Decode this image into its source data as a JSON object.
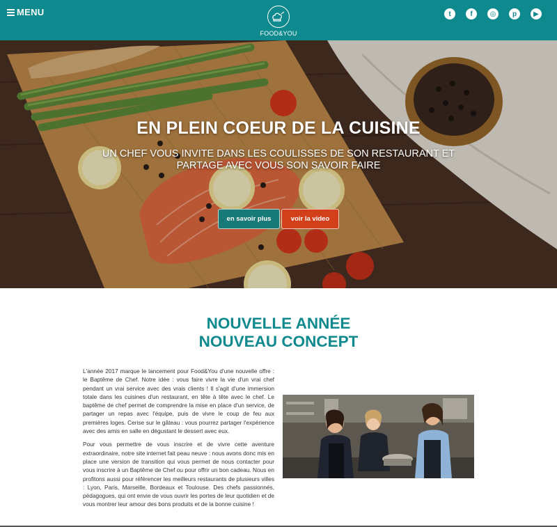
{
  "header": {
    "menu_label": "MENU",
    "logo_text": "FOOD&YOU",
    "socials": [
      {
        "icon": "twitter-icon",
        "glyph": "t"
      },
      {
        "icon": "facebook-icon",
        "glyph": "f"
      },
      {
        "icon": "instagram-icon",
        "glyph": "◎"
      },
      {
        "icon": "pinterest-icon",
        "glyph": "p"
      },
      {
        "icon": "youtube-icon",
        "glyph": "▶"
      }
    ],
    "background": "#0e8a8f"
  },
  "hero": {
    "title": "EN PLEIN COEUR DE LA CUISINE",
    "subtitle": "UN CHEF VOUS INVITE DANS LES COULISSES DE SON RESTAURANT ET PARTAGE AVEC VOUS SON SAVOIR FAIRE",
    "primary_button": "en savoir plus",
    "secondary_button": "voir la video",
    "primary_color": "#187a76",
    "secondary_color": "#d2401b"
  },
  "content": {
    "title_line1": "NOUVELLE ANNÉE",
    "title_line2": "NOUVEAU CONCEPT",
    "paragraph1": "L'année 2017 marque le lancement pour Food&You d'une nouvelle offre : le Baptême de Chef. Notre idée : vous faire vivre la vie d'un vrai chef pendant un vrai service avec des vrais clients ! Il s'agit d'une immersion totale dans les cuisines d'un restaurant, en tête à tête avec le chef. Le baptême de chef permet de comprendre la mise en place d'un service, de partager un repas avec l'équipe, puis de vivre le coup de feu aux premières loges. Cerise sur le gâteau : vous pourrez partager l'expérience avec des amis en salle en dégustant le dessert avec eux.",
    "paragraph2": "Pour vous permettre de vous inscrire et de vivre cette aventure extraordinaire, notre site internet fait peau neuve : nous avons donc mis en place une version de transition qui vous permet de nous contacter pour vous inscrire à un Baptême de Chef ou pour offrir un bon cadeau. Nous en profitons aussi pour référencer les meilleurs restaurants de plusieurs villes : Lyon, Paris, Marseille, Bordeaux et Toulouse. Des chefs passionnés, pédagogues, qui ont envie de vous ouvrir les portes de leur quotidien et de vous montrer leur amour des bons produits et de la bonne cuisine !"
  }
}
